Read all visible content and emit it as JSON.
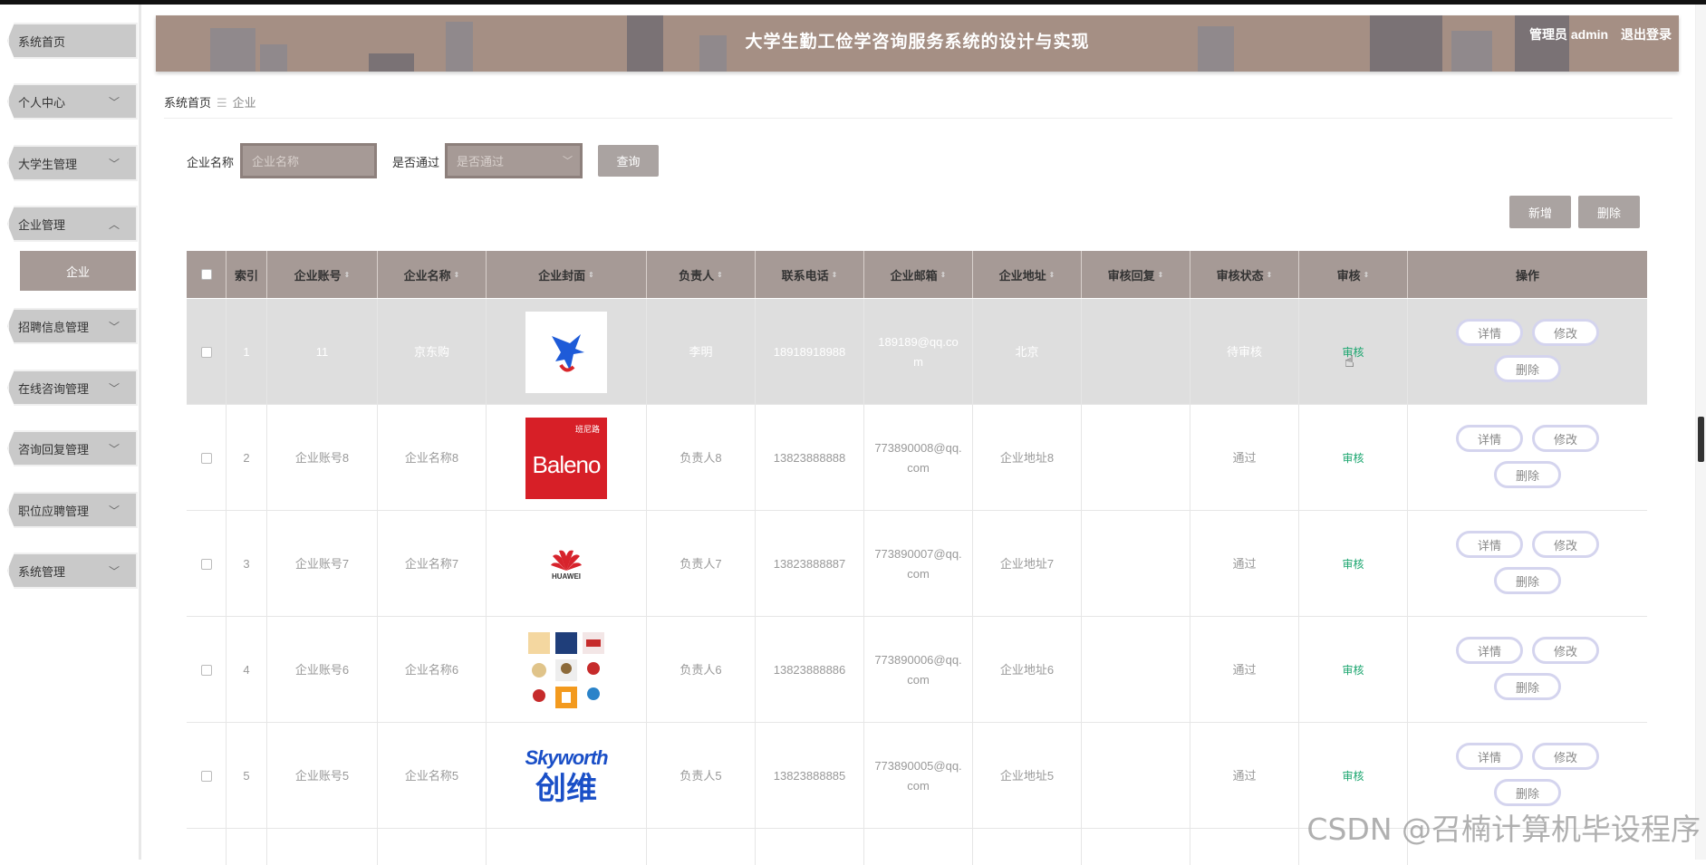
{
  "header": {
    "title": "大学生勤工俭学咨询服务系统的设计与实现",
    "user_label": "管理员 admin",
    "logout_label": "退出登录"
  },
  "sidebar": {
    "items": [
      {
        "label": "系统首页",
        "has_chevron": false
      },
      {
        "label": "个人中心",
        "has_chevron": true
      },
      {
        "label": "大学生管理",
        "has_chevron": true
      },
      {
        "label": "企业管理",
        "has_chevron": true
      },
      {
        "label": "招聘信息管理",
        "has_chevron": true
      },
      {
        "label": "在线咨询管理",
        "has_chevron": true
      },
      {
        "label": "咨询回复管理",
        "has_chevron": true
      },
      {
        "label": "职位应聘管理",
        "has_chevron": true
      },
      {
        "label": "系统管理",
        "has_chevron": true
      }
    ],
    "sub_item": "企业"
  },
  "breadcrumb": {
    "home": "系统首页",
    "current": "企业"
  },
  "search": {
    "name_label": "企业名称",
    "name_placeholder": "企业名称",
    "pass_label": "是否通过",
    "pass_placeholder": "是否通过",
    "query_button": "查询"
  },
  "actions": {
    "add_button": "新增",
    "delete_button": "删除"
  },
  "table": {
    "columns": [
      "索引",
      "企业账号",
      "企业名称",
      "企业封面",
      "负责人",
      "联系电话",
      "企业邮箱",
      "企业地址",
      "审核回复",
      "审核状态",
      "审核",
      "操作"
    ],
    "rows": [
      {
        "index": "1",
        "account": "11",
        "name": "京东购",
        "cover": "eagle-logo",
        "owner": "李明",
        "phone": "18918918988",
        "email_l1": "189189@qq.co",
        "email_l2": "m",
        "address": "北京",
        "reply": "",
        "status": "待审核",
        "audit": "审核"
      },
      {
        "index": "2",
        "account": "企业账号8",
        "name": "企业名称8",
        "cover": "baleno-logo",
        "owner": "负责人8",
        "phone": "13823888888",
        "email_l1": "773890008@qq.",
        "email_l2": "com",
        "address": "企业地址8",
        "reply": "",
        "status": "通过",
        "audit": "审核"
      },
      {
        "index": "3",
        "account": "企业账号7",
        "name": "企业名称7",
        "cover": "huawei-logo",
        "owner": "负责人7",
        "phone": "13823888887",
        "email_l1": "773890007@qq.",
        "email_l2": "com",
        "address": "企业地址7",
        "reply": "",
        "status": "通过",
        "audit": "审核"
      },
      {
        "index": "4",
        "account": "企业账号6",
        "name": "企业名称6",
        "cover": "logo-grid",
        "owner": "负责人6",
        "phone": "13823888886",
        "email_l1": "773890006@qq.",
        "email_l2": "com",
        "address": "企业地址6",
        "reply": "",
        "status": "通过",
        "audit": "审核"
      },
      {
        "index": "5",
        "account": "企业账号5",
        "name": "企业名称5",
        "cover": "skyworth-logo",
        "owner": "负责人5",
        "phone": "13823888885",
        "email_l1": "773890005@qq.",
        "email_l2": "com",
        "address": "企业地址5",
        "reply": "",
        "status": "通过",
        "audit": "审核"
      }
    ],
    "op_detail": "详情",
    "op_edit": "修改",
    "op_delete": "删除"
  },
  "logos": {
    "baleno_cn": "班尼路",
    "baleno_en": "Baleno",
    "huawei_text": "HUAWEI",
    "skyworth_en": "Skyworth",
    "skyworth_cn": "创维"
  },
  "watermark": "CSDN @召楠计算机毕设程序",
  "colors": {
    "header_bg": "#a58f84",
    "accent": "#a69a96",
    "audit_green": "#1aa56e",
    "pill_border": "#d4d4ee"
  }
}
